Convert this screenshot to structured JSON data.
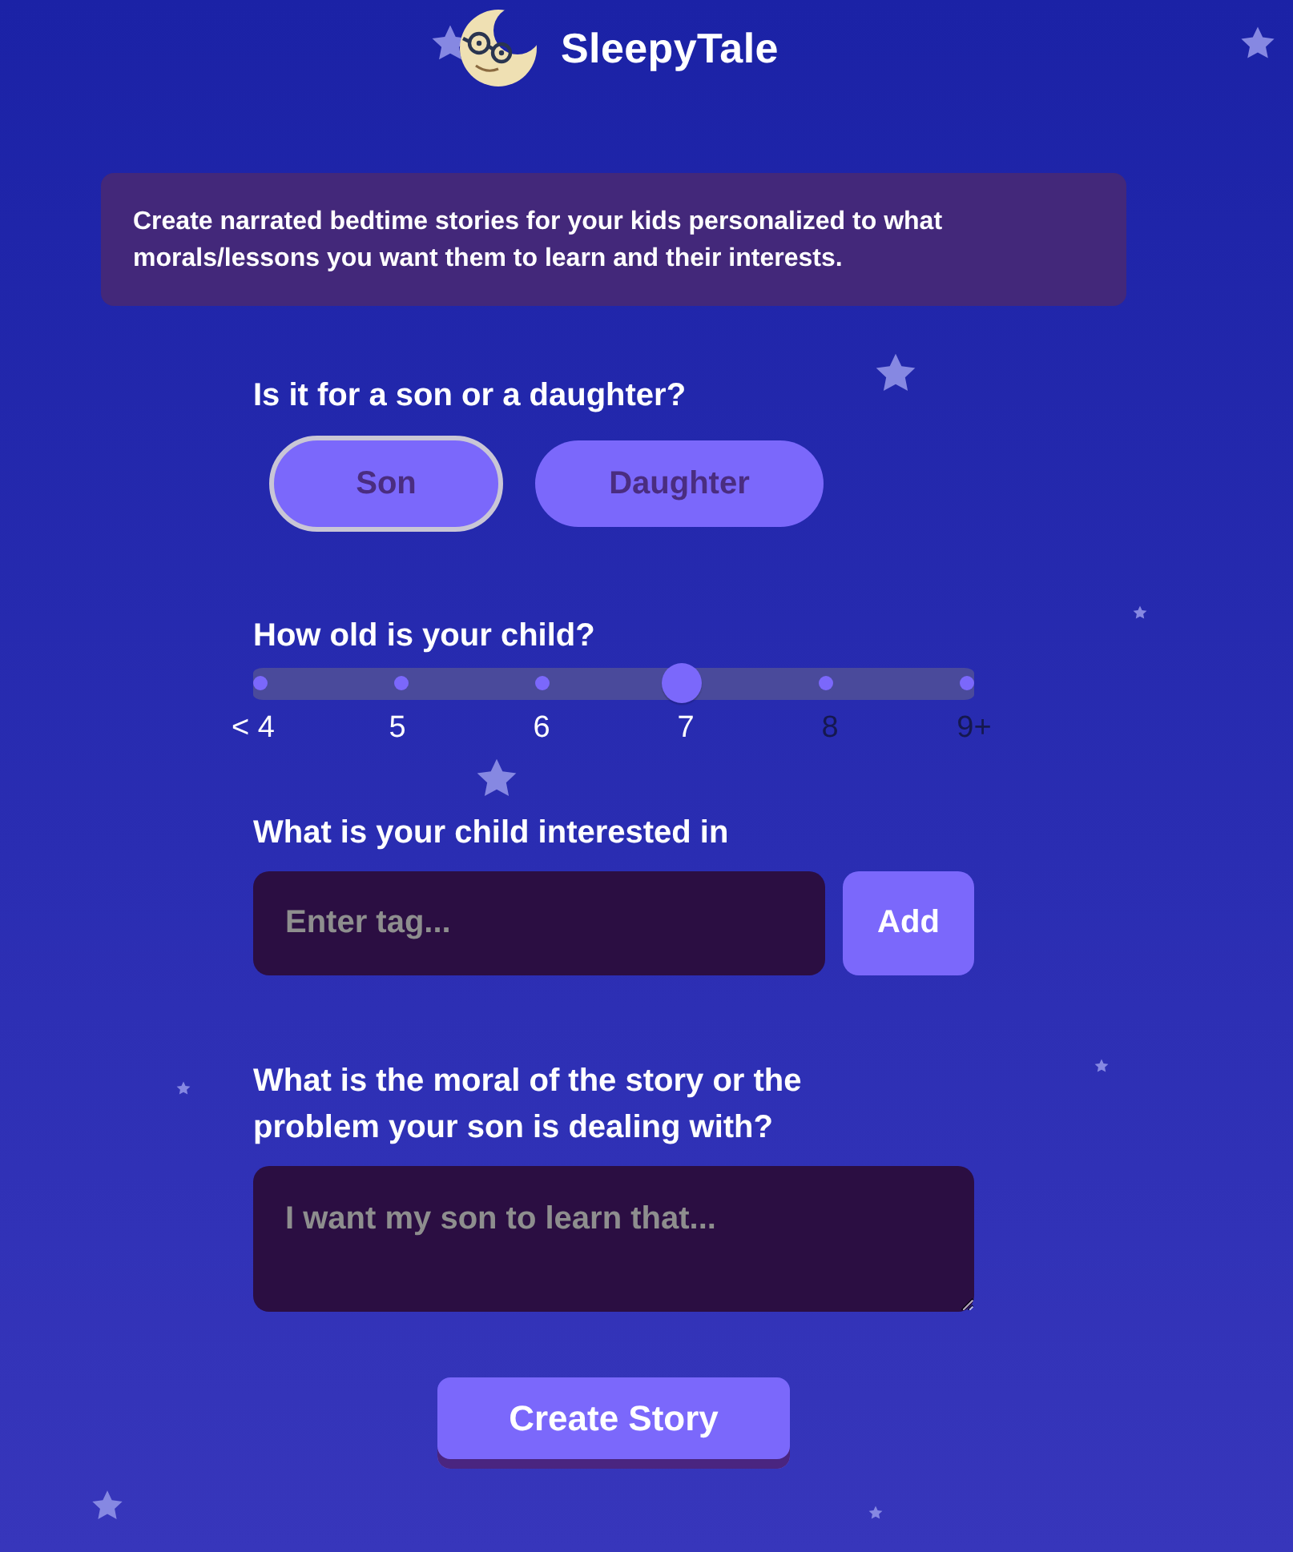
{
  "header": {
    "title": "SleepyTale"
  },
  "intro": {
    "text": "Create narrated bedtime stories for your kids personalized to what morals/lessons you want them to learn and their interests."
  },
  "gender": {
    "label": "Is it for a son or a daughter?",
    "options": [
      {
        "label": "Son",
        "selected": true
      },
      {
        "label": "Daughter",
        "selected": false
      }
    ]
  },
  "age": {
    "label": "How old is your child?",
    "level": 0.6,
    "marks": [
      "< 4",
      "5",
      "6",
      "7",
      "8",
      "9+"
    ]
  },
  "interests": {
    "label": "What is your child interested in",
    "placeholder": "Enter tag...",
    "button": "Add"
  },
  "moral": {
    "label": "What is the moral of the story or the problem your son is dealing with?",
    "placeholder": "I want my son to learn that..."
  },
  "submit": {
    "label": "Create Story"
  }
}
